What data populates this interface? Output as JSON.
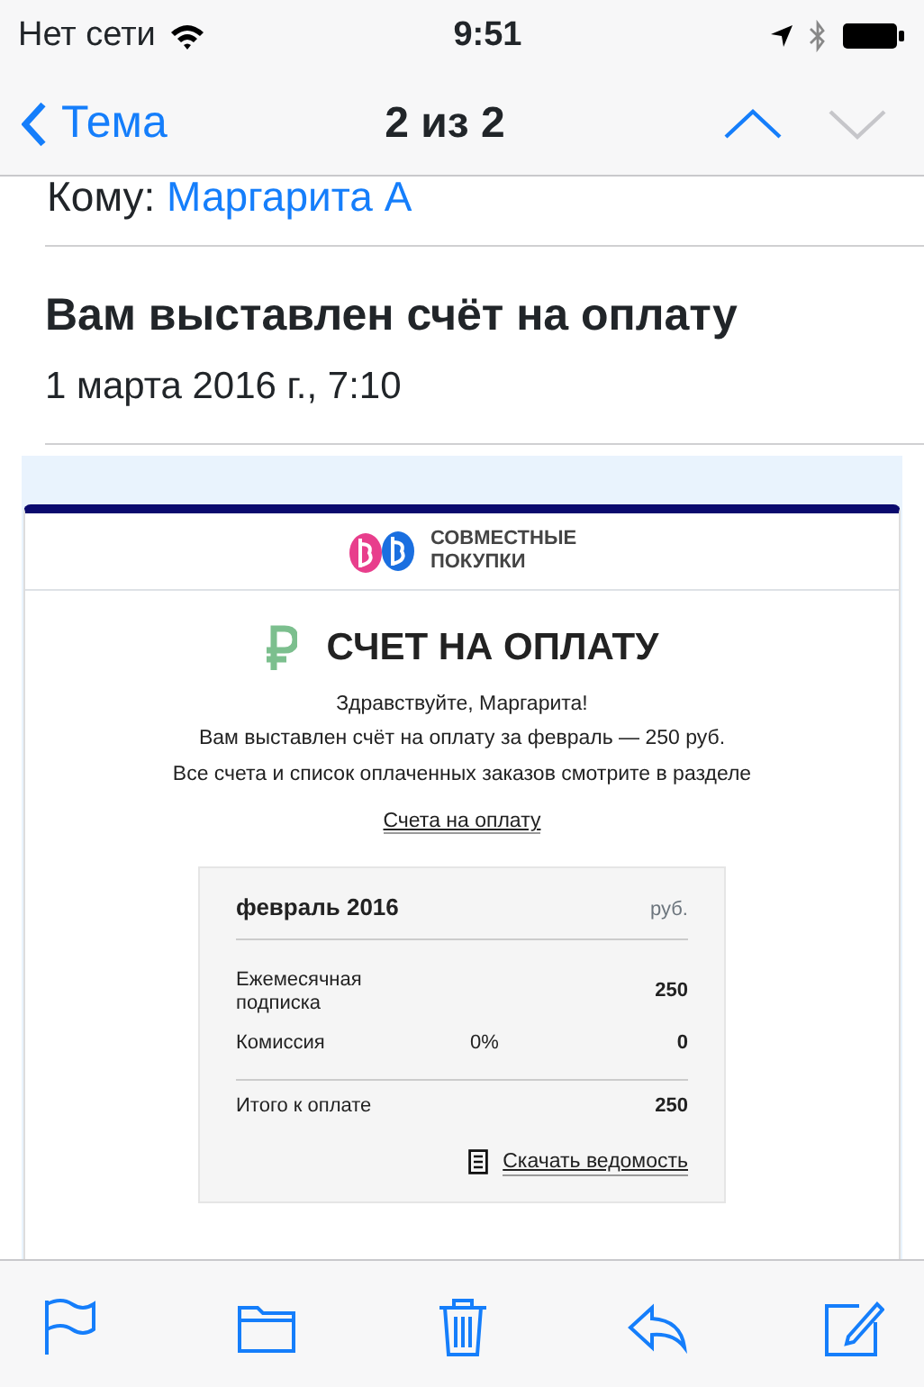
{
  "status_bar": {
    "carrier": "Нет сети",
    "time": "9:51"
  },
  "nav": {
    "back": "Тема",
    "title": "2 из 2",
    "arrows": [
      {
        "kind": "up",
        "disabled": false
      },
      {
        "kind": "down",
        "disabled": true
      }
    ]
  },
  "header": {
    "to_label": "Кому:",
    "to_name": "Маргарита А",
    "subject": "Вам выставлен счёт на оплату",
    "date": "1 марта 2016 г., 7:10"
  },
  "email": {
    "brand_lines": [
      "СОВМЕСТНЫЕ",
      "ПОКУПКИ"
    ],
    "heading": "СЧЕТ НА ОПЛАТУ",
    "paragraphs": [
      "Здравствуйте, Маргарита!",
      "Вам выставлен счёт на оплату за февраль — 250 руб.",
      "Все счета и список оплаченных заказов смотрите в разделе"
    ],
    "link": "Счета на оплату",
    "invoice": {
      "month": "февраль 2016",
      "currency": "руб.",
      "rows": [
        {
          "label": "Ежемесячная подписка",
          "rate": "",
          "amount": "250"
        },
        {
          "label": "Комиссия",
          "rate": "0%",
          "amount": "0"
        }
      ],
      "total": {
        "label": "Итого к оплате",
        "amount": "250"
      },
      "download": "Скачать ведомость"
    }
  }
}
